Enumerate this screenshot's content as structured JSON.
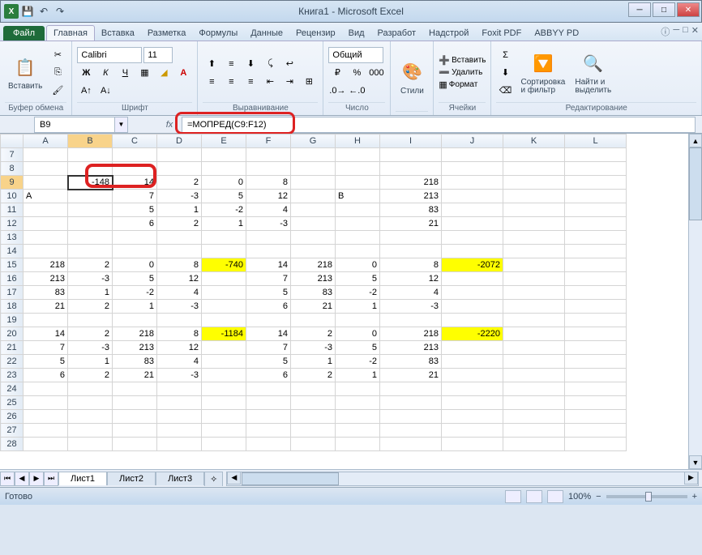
{
  "window": {
    "title": "Книга1 - Microsoft Excel"
  },
  "tabs": {
    "file": "Файл",
    "items": [
      "Главная",
      "Вставка",
      "Разметка",
      "Формулы",
      "Данные",
      "Рецензир",
      "Вид",
      "Разработ",
      "Надстрой",
      "Foxit PDF",
      "ABBYY PD"
    ],
    "active": 0
  },
  "ribbon": {
    "clipboard": {
      "label": "Буфер обмена",
      "paste": "Вставить"
    },
    "font": {
      "label": "Шрифт",
      "name": "Calibri",
      "size": "11"
    },
    "alignment": {
      "label": "Выравнивание"
    },
    "number": {
      "label": "Число",
      "format": "Общий"
    },
    "styles": {
      "label": "",
      "btn": "Стили"
    },
    "cells": {
      "label": "Ячейки",
      "insert": "Вставить",
      "delete": "Удалить",
      "format": "Формат"
    },
    "editing": {
      "label": "Редактирование",
      "sort": "Сортировка\nи фильтр",
      "find": "Найти и\nвыделить"
    }
  },
  "namebox": "B9",
  "formula": "=МОПРЕД(C9:F12)",
  "columns": [
    "A",
    "B",
    "C",
    "D",
    "E",
    "F",
    "G",
    "H",
    "I",
    "J",
    "K",
    "L"
  ],
  "selected_col": "B",
  "selected_row": "9",
  "rows": [
    {
      "n": "7",
      "c": [
        "",
        "",
        "",
        "",
        "",
        "",
        "",
        "",
        "",
        "",
        "",
        ""
      ]
    },
    {
      "n": "8",
      "c": [
        "",
        "",
        "",
        "",
        "",
        "",
        "",
        "",
        "",
        "",
        "",
        ""
      ]
    },
    {
      "n": "9",
      "c": [
        "",
        "-148",
        "14",
        "2",
        "0",
        "8",
        "",
        "",
        "218",
        "",
        "",
        ""
      ],
      "sel": 1,
      "hl": []
    },
    {
      "n": "10",
      "c": [
        "A",
        "",
        "7",
        "-3",
        "5",
        "12",
        "",
        "B",
        "213",
        "",
        "",
        ""
      ],
      "txt": [
        0,
        7
      ]
    },
    {
      "n": "11",
      "c": [
        "",
        "",
        "5",
        "1",
        "-2",
        "4",
        "",
        "",
        "83",
        "",
        "",
        ""
      ]
    },
    {
      "n": "12",
      "c": [
        "",
        "",
        "6",
        "2",
        "1",
        "-3",
        "",
        "",
        "21",
        "",
        "",
        ""
      ]
    },
    {
      "n": "13",
      "c": [
        "",
        "",
        "",
        "",
        "",
        "",
        "",
        "",
        "",
        "",
        "",
        ""
      ]
    },
    {
      "n": "14",
      "c": [
        "",
        "",
        "",
        "",
        "",
        "",
        "",
        "",
        "",
        "",
        "",
        ""
      ]
    },
    {
      "n": "15",
      "c": [
        "218",
        "2",
        "0",
        "8",
        "-740",
        "14",
        "218",
        "0",
        "8",
        "-2072",
        "",
        ""
      ],
      "hl": [
        4,
        9
      ]
    },
    {
      "n": "16",
      "c": [
        "213",
        "-3",
        "5",
        "12",
        "",
        "7",
        "213",
        "5",
        "12",
        "",
        "",
        ""
      ]
    },
    {
      "n": "17",
      "c": [
        "83",
        "1",
        "-2",
        "4",
        "",
        "5",
        "83",
        "-2",
        "4",
        "",
        "",
        ""
      ]
    },
    {
      "n": "18",
      "c": [
        "21",
        "2",
        "1",
        "-3",
        "",
        "6",
        "21",
        "1",
        "-3",
        "",
        "",
        ""
      ]
    },
    {
      "n": "19",
      "c": [
        "",
        "",
        "",
        "",
        "",
        "",
        "",
        "",
        "",
        "",
        "",
        ""
      ]
    },
    {
      "n": "20",
      "c": [
        "14",
        "2",
        "218",
        "8",
        "-1184",
        "14",
        "2",
        "0",
        "218",
        "-2220",
        "",
        ""
      ],
      "hl": [
        4,
        9
      ]
    },
    {
      "n": "21",
      "c": [
        "7",
        "-3",
        "213",
        "12",
        "",
        "7",
        "-3",
        "5",
        "213",
        "",
        "",
        ""
      ]
    },
    {
      "n": "22",
      "c": [
        "5",
        "1",
        "83",
        "4",
        "",
        "5",
        "1",
        "-2",
        "83",
        "",
        "",
        ""
      ]
    },
    {
      "n": "23",
      "c": [
        "6",
        "2",
        "21",
        "-3",
        "",
        "6",
        "2",
        "1",
        "21",
        "",
        "",
        ""
      ]
    },
    {
      "n": "24",
      "c": [
        "",
        "",
        "",
        "",
        "",
        "",
        "",
        "",
        "",
        "",
        "",
        ""
      ]
    },
    {
      "n": "25",
      "c": [
        "",
        "",
        "",
        "",
        "",
        "",
        "",
        "",
        "",
        "",
        "",
        ""
      ]
    },
    {
      "n": "26",
      "c": [
        "",
        "",
        "",
        "",
        "",
        "",
        "",
        "",
        "",
        "",
        "",
        ""
      ]
    },
    {
      "n": "27",
      "c": [
        "",
        "",
        "",
        "",
        "",
        "",
        "",
        "",
        "",
        "",
        "",
        ""
      ]
    },
    {
      "n": "28",
      "c": [
        "",
        "",
        "",
        "",
        "",
        "",
        "",
        "",
        "",
        "",
        "",
        ""
      ]
    }
  ],
  "sheets": {
    "items": [
      "Лист1",
      "Лист2",
      "Лист3"
    ],
    "active": 0
  },
  "status": {
    "ready": "Готово",
    "zoom": "100%"
  }
}
